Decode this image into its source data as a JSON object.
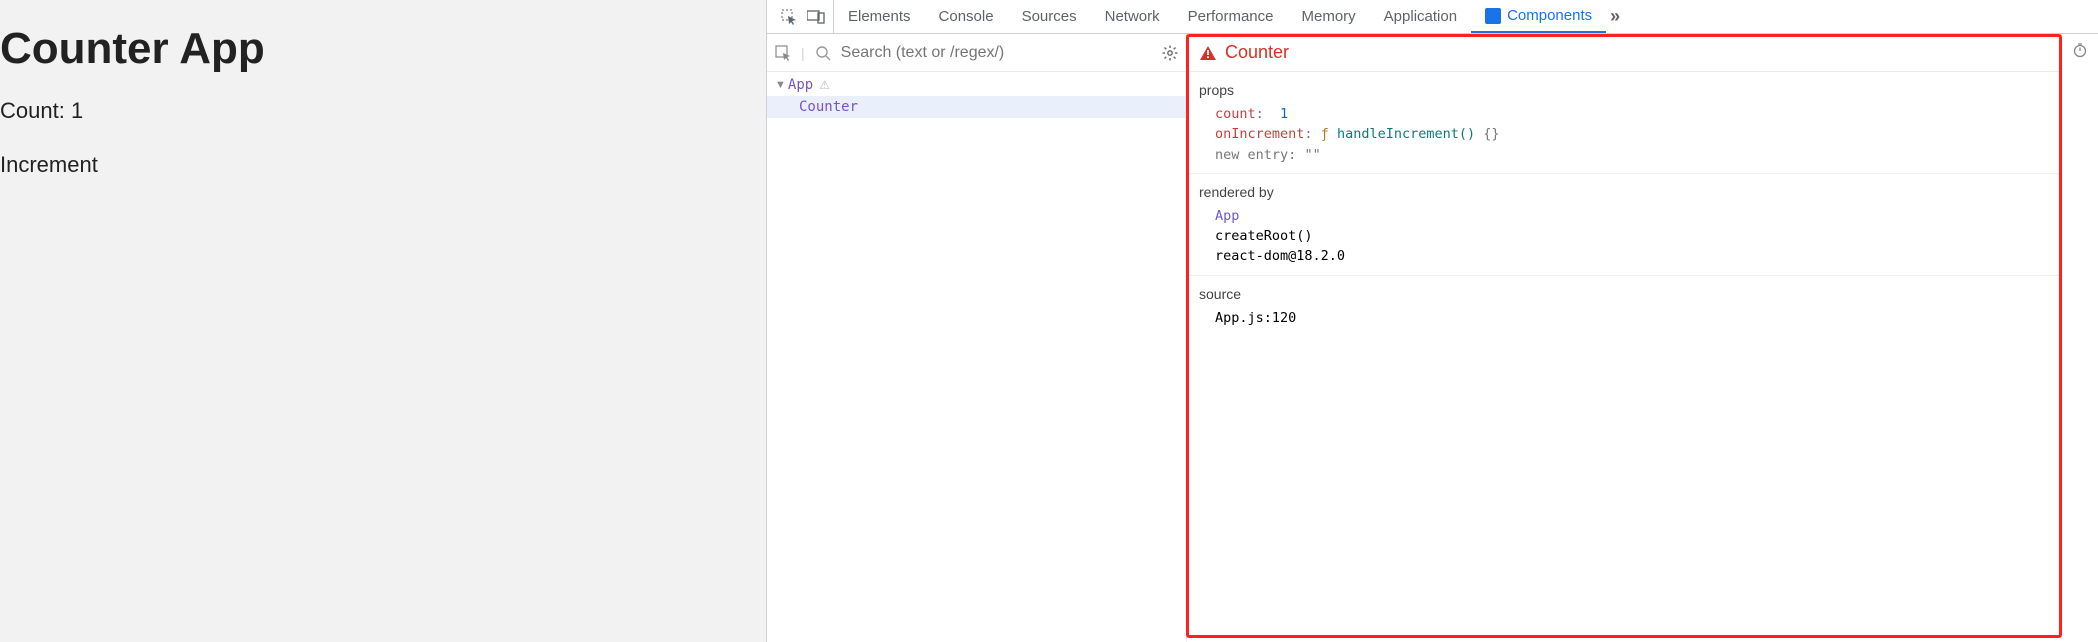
{
  "app": {
    "title": "Counter App",
    "count_label": "Count:",
    "count_value": "1",
    "increment_label": "Increment"
  },
  "devtools": {
    "tabs": {
      "elements": "Elements",
      "console": "Console",
      "sources": "Sources",
      "network": "Network",
      "performance": "Performance",
      "memory": "Memory",
      "application": "Application",
      "components": "Components",
      "overflow": "»"
    },
    "components_panel": {
      "search_placeholder": "Search (text or /regex/)",
      "tree": {
        "root": "App",
        "selected": "Counter"
      },
      "details": {
        "title": "Counter",
        "sections": {
          "props": {
            "label": "props",
            "count_key": "count",
            "count_val": "1",
            "onIncrement_key": "onIncrement",
            "onIncrement_sym": "ƒ",
            "onIncrement_name": "handleIncrement()",
            "onIncrement_braces": "{}",
            "newentry_key": "new entry",
            "newentry_val": "\"\""
          },
          "rendered_by": {
            "label": "rendered by",
            "app": "App",
            "createRoot": "createRoot()",
            "reactdom": "react-dom@18.2.0"
          },
          "source": {
            "label": "source",
            "file": "App.js:120"
          }
        }
      }
    }
  }
}
